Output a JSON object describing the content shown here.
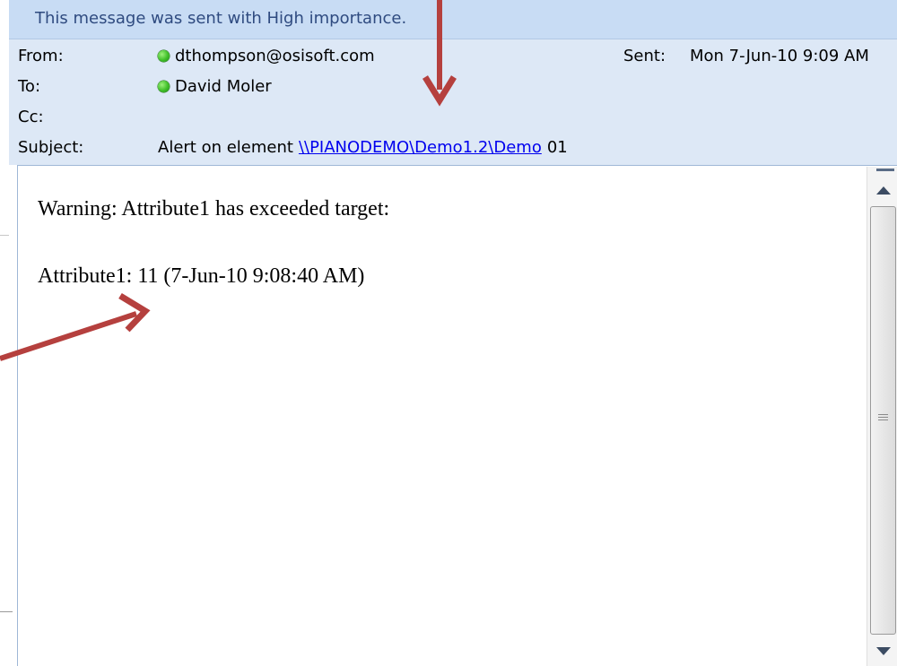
{
  "message_header": {
    "importance_banner": "This message was sent with High importance.",
    "from": {
      "label": "From:",
      "value": "dthompson@osisoft.com"
    },
    "sent": {
      "label": "Sent:",
      "value": "Mon 7-Jun-10 9:09 AM"
    },
    "to": {
      "label": "To:",
      "value": "David Moler"
    },
    "cc": {
      "label": "Cc:",
      "value": ""
    },
    "subject": {
      "label": "Subject:",
      "prefix": "Alert on element",
      "link": "\\\\PIANODEMO\\Demo1.2\\Demo",
      "suffix": "01"
    }
  },
  "message_body": {
    "line1": "Warning: Attribute1 has exceeded target:",
    "line2": "Attribute1: 11 (7-Jun-10 9:08:40 AM)"
  },
  "colors": {
    "header_background": "#dde8f6",
    "banner_background": "#c8dcf4",
    "banner_text": "#2f4b80",
    "presence_online": "#3fbf28",
    "annotation_arrow": "#b5403e",
    "link": "#0000ee"
  },
  "icons": {
    "presence": "presence-online-icon",
    "scroll_up": "scroll-up-arrow-icon",
    "scroll_down": "scroll-down-arrow-icon",
    "annotation": "annotation-arrow-icon"
  }
}
